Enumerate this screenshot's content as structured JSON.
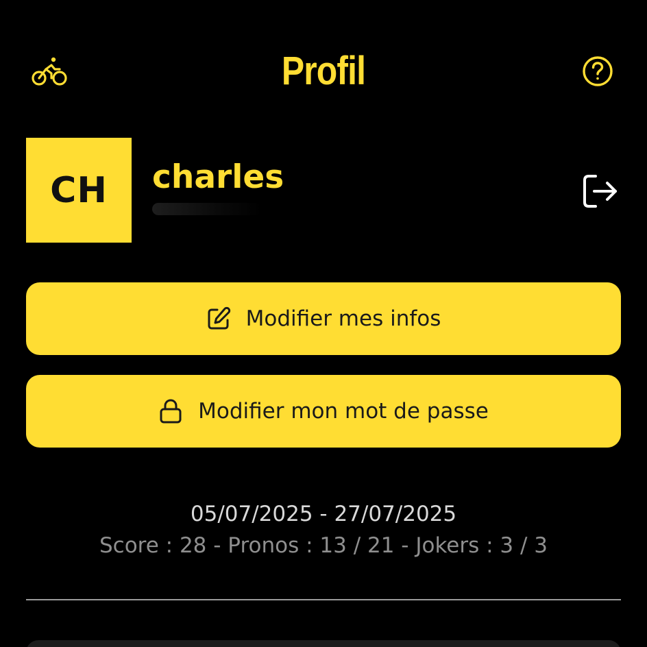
{
  "header": {
    "title": "Profil",
    "left_icon": "bike-icon",
    "right_icon": "help-icon"
  },
  "profile": {
    "initials": "CH",
    "username": "charles",
    "logout_icon": "logout-icon"
  },
  "actions": {
    "edit_label": "Modifier mes infos",
    "edit_icon": "edit-icon",
    "password_label": "Modifier mon mot de passe",
    "password_icon": "lock-icon"
  },
  "season": {
    "period": "05/07/2025 - 27/07/2025",
    "stats": "Score : 28 - Pronos : 13 / 21 - Jokers : 3 / 3"
  },
  "colors": {
    "accent": "#FFDD33",
    "background": "#000000",
    "text_dark": "#1a1a1a",
    "stats_gray": "#8f8f8f"
  }
}
